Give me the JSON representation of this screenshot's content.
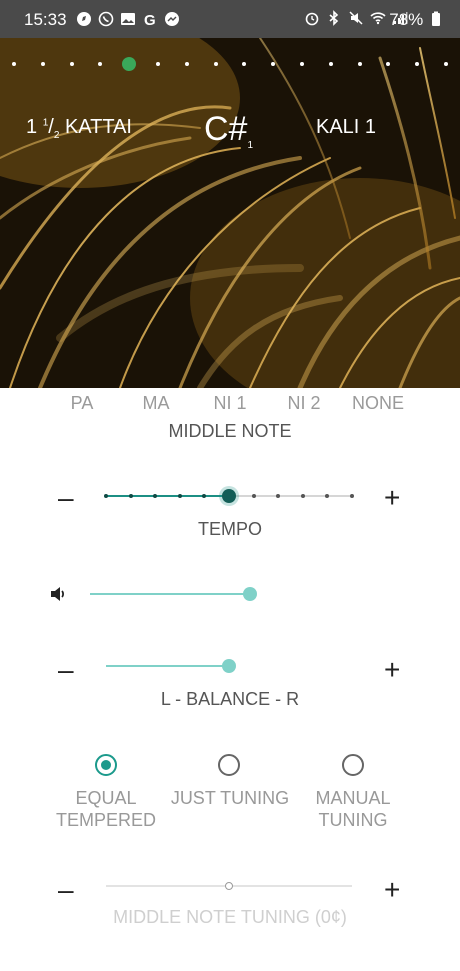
{
  "status": {
    "time": "15:33",
    "battery": "78%"
  },
  "hero": {
    "page_count": 16,
    "active_page": 4,
    "left_label_num": "1",
    "left_label_sup": "1",
    "left_label_sub": "2",
    "left_label_text": "KATTAI",
    "center_label": "C#",
    "center_label_sub": "1",
    "right_label": "KALI 1"
  },
  "middle_note": {
    "options": [
      "PA",
      "MA",
      "NI 1",
      "NI 2",
      "NONE"
    ],
    "label": "MIDDLE NOTE"
  },
  "tempo": {
    "minus": "–",
    "plus": "+",
    "label": "TEMPO",
    "steps": 11,
    "value_step": 5,
    "accent": "#1c8f84"
  },
  "volume": {
    "icon": "speaker-icon",
    "level": 0.74,
    "accent": "#7fd1c8"
  },
  "balance": {
    "minus": "–",
    "plus": "+",
    "label": "L - BALANCE - R",
    "level": 0.5,
    "accent": "#7fd1c8"
  },
  "tuning": {
    "options": [
      {
        "line1": "EQUAL",
        "line2": "TEMPERED",
        "selected": true
      },
      {
        "line1": "JUST TUNING",
        "line2": "",
        "selected": false
      },
      {
        "line1": "MANUAL",
        "line2": "TUNING",
        "selected": false
      }
    ]
  },
  "middle_note_tuning": {
    "minus": "–",
    "plus": "+",
    "label": "MIDDLE NOTE TUNING (0¢)",
    "level": 0.5
  }
}
